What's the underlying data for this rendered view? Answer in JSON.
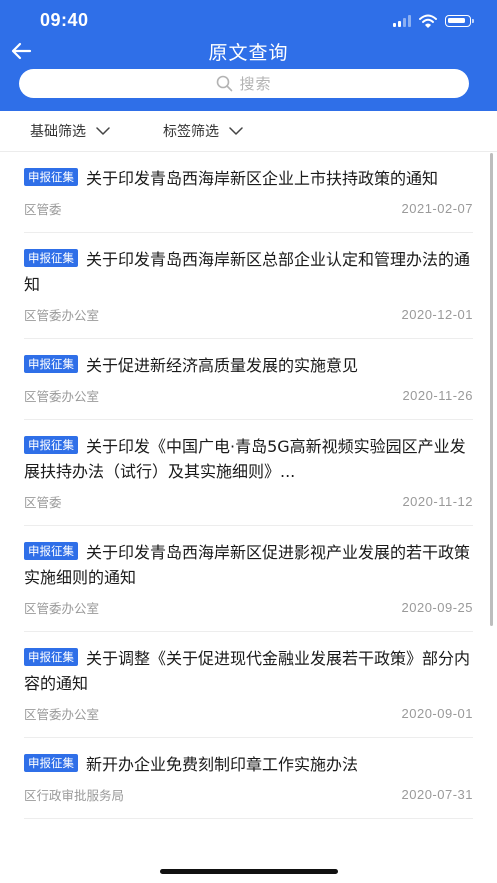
{
  "status_bar": {
    "time": "09:40"
  },
  "nav": {
    "title": "原文查询"
  },
  "search": {
    "placeholder": "搜索"
  },
  "filters": {
    "basic": "基础筛选",
    "tags": "标签筛选"
  },
  "list": [
    {
      "badge": "申报征集",
      "title": "关于印发青岛西海岸新区企业上市扶持政策的通知",
      "source": "区管委",
      "date": "2021-02-07"
    },
    {
      "badge": "申报征集",
      "title": "关于印发青岛西海岸新区总部企业认定和管理办法的通知",
      "source": "区管委办公室",
      "date": "2020-12-01"
    },
    {
      "badge": "申报征集",
      "title": "关于促进新经济高质量发展的实施意见",
      "source": "区管委办公室",
      "date": "2020-11-26"
    },
    {
      "badge": "申报征集",
      "title": "关于印发《中国广电·青岛5G高新视频实验园区产业发展扶持办法（试行）及其实施细则》...",
      "source": "区管委",
      "date": "2020-11-12"
    },
    {
      "badge": "申报征集",
      "title": "关于印发青岛西海岸新区促进影视产业发展的若干政策实施细则的通知",
      "source": "区管委办公室",
      "date": "2020-09-25"
    },
    {
      "badge": "申报征集",
      "title": "关于调整《关于促进现代金融业发展若干政策》部分内容的通知",
      "source": "区管委办公室",
      "date": "2020-09-01"
    },
    {
      "badge": "申报征集",
      "title": "新开办企业免费刻制印章工作实施办法",
      "source": "区行政审批服务局",
      "date": "2020-07-31"
    }
  ],
  "colors": {
    "primary": "#2f6fe8",
    "text": "#1a1a1a",
    "meta": "#9a9a9a"
  },
  "icons": [
    "back-arrow-icon",
    "search-icon",
    "chevron-down-icon",
    "signal-icon",
    "wifi-icon",
    "battery-icon"
  ]
}
